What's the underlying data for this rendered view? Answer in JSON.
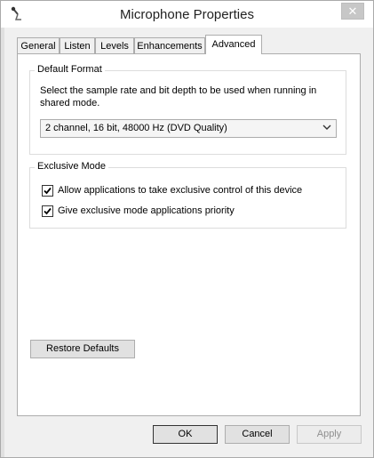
{
  "window": {
    "title": "Microphone Properties",
    "close_glyph": "✕",
    "icon": "microphone-icon"
  },
  "tabs": [
    {
      "label": "General",
      "selected": false
    },
    {
      "label": "Listen",
      "selected": false
    },
    {
      "label": "Levels",
      "selected": false
    },
    {
      "label": "Enhancements",
      "selected": false
    },
    {
      "label": "Advanced",
      "selected": true
    }
  ],
  "default_format": {
    "legend": "Default Format",
    "description": "Select the sample rate and bit depth to be used when running in shared mode.",
    "selected_format": "2 channel, 16 bit, 48000 Hz (DVD Quality)"
  },
  "exclusive_mode": {
    "legend": "Exclusive Mode",
    "options": [
      {
        "label": "Allow applications to take exclusive control of this device",
        "checked": true
      },
      {
        "label": "Give exclusive mode applications priority",
        "checked": true
      }
    ]
  },
  "restore_defaults_label": "Restore Defaults",
  "footer": {
    "ok_label": "OK",
    "cancel_label": "Cancel",
    "apply_label": "Apply"
  }
}
